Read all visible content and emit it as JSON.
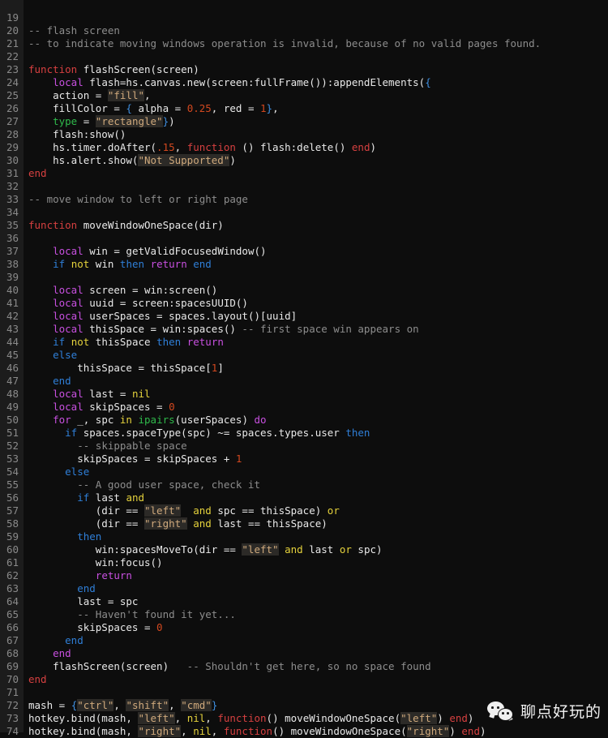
{
  "editor": {
    "language": "lua",
    "theme": "dark",
    "background_color": "#0d0d0d",
    "gutter_color": "#1c1c1c",
    "first_visible_line": 19,
    "last_visible_line": 74,
    "colors": {
      "plain": "#e9e9e9",
      "comment": "#8d8d8d",
      "keyword_red": "#d64040",
      "keyword_magenta": "#c850e0",
      "keyword_blue": "#2f7fd8",
      "keyword_yellow": "#e5d23c",
      "green": "#2fb94b",
      "number": "#d2481f",
      "brace": "#3f8fe0",
      "string_text": "#cfa97c",
      "string_background": "#2c2a27",
      "line_number": "#8a8a8a"
    }
  },
  "watermark": {
    "logo_icon": "wechat-logo-icon",
    "text": "聊点好玩的"
  },
  "lines": [
    {
      "n": 19,
      "tokens": []
    },
    {
      "n": 20,
      "tokens": [
        {
          "t": "-- flash screen",
          "c": "comment"
        }
      ]
    },
    {
      "n": 21,
      "tokens": [
        {
          "t": "-- to indicate moving windows operation is invalid, because of no valid pages found.",
          "c": "comment"
        }
      ]
    },
    {
      "n": 22,
      "tokens": []
    },
    {
      "n": 23,
      "tokens": [
        {
          "t": "function",
          "c": "kw-red"
        },
        {
          "t": " flashScreen(screen)",
          "c": "plain"
        }
      ]
    },
    {
      "n": 24,
      "tokens": [
        {
          "t": "    ",
          "c": "plain"
        },
        {
          "t": "local",
          "c": "kw-mag"
        },
        {
          "t": " flash=hs.canvas.new(screen:fullFrame()):appendElements(",
          "c": "plain"
        },
        {
          "t": "{",
          "c": "brace"
        }
      ]
    },
    {
      "n": 25,
      "tokens": [
        {
          "t": "    action = ",
          "c": "plain"
        },
        {
          "t": "\"fill\"",
          "c": "str"
        },
        {
          "t": ",",
          "c": "plain"
        }
      ]
    },
    {
      "n": 26,
      "tokens": [
        {
          "t": "    fillColor = ",
          "c": "plain"
        },
        {
          "t": "{",
          "c": "brace"
        },
        {
          "t": " alpha = ",
          "c": "plain"
        },
        {
          "t": "0.25",
          "c": "num"
        },
        {
          "t": ", red = ",
          "c": "plain"
        },
        {
          "t": "1",
          "c": "num"
        },
        {
          "t": "}",
          "c": "brace"
        },
        {
          "t": ",",
          "c": "plain"
        }
      ]
    },
    {
      "n": 27,
      "tokens": [
        {
          "t": "    ",
          "c": "plain"
        },
        {
          "t": "type",
          "c": "grn"
        },
        {
          "t": " = ",
          "c": "plain"
        },
        {
          "t": "\"rectangle\"",
          "c": "str"
        },
        {
          "t": "}",
          "c": "brace"
        },
        {
          "t": ")",
          "c": "plain"
        }
      ]
    },
    {
      "n": 28,
      "tokens": [
        {
          "t": "    flash:show()",
          "c": "plain"
        }
      ]
    },
    {
      "n": 29,
      "tokens": [
        {
          "t": "    hs.timer.doAfter(",
          "c": "plain"
        },
        {
          "t": ".15",
          "c": "num"
        },
        {
          "t": ", ",
          "c": "plain"
        },
        {
          "t": "function",
          "c": "kw-red"
        },
        {
          "t": " () flash:delete() ",
          "c": "plain"
        },
        {
          "t": "end",
          "c": "kw-red"
        },
        {
          "t": ")",
          "c": "plain"
        }
      ]
    },
    {
      "n": 30,
      "tokens": [
        {
          "t": "    hs.alert.show(",
          "c": "plain"
        },
        {
          "t": "\"Not Supported\"",
          "c": "str"
        },
        {
          "t": ")",
          "c": "plain"
        }
      ]
    },
    {
      "n": 31,
      "tokens": [
        {
          "t": "end",
          "c": "kw-red"
        }
      ]
    },
    {
      "n": 32,
      "tokens": []
    },
    {
      "n": 33,
      "tokens": [
        {
          "t": "-- move window to left or right page",
          "c": "comment"
        }
      ]
    },
    {
      "n": 34,
      "tokens": []
    },
    {
      "n": 35,
      "tokens": [
        {
          "t": "function",
          "c": "kw-red"
        },
        {
          "t": " moveWindowOneSpace(dir)",
          "c": "plain"
        }
      ]
    },
    {
      "n": 36,
      "tokens": []
    },
    {
      "n": 37,
      "tokens": [
        {
          "t": "    ",
          "c": "plain"
        },
        {
          "t": "local",
          "c": "kw-mag"
        },
        {
          "t": " win = getValidFocusedWindow()",
          "c": "plain"
        }
      ]
    },
    {
      "n": 38,
      "tokens": [
        {
          "t": "    ",
          "c": "plain"
        },
        {
          "t": "if",
          "c": "kw-blue"
        },
        {
          "t": " ",
          "c": "plain"
        },
        {
          "t": "not",
          "c": "kw-yel"
        },
        {
          "t": " win ",
          "c": "plain"
        },
        {
          "t": "then",
          "c": "kw-blue"
        },
        {
          "t": " ",
          "c": "plain"
        },
        {
          "t": "return",
          "c": "kw-mag"
        },
        {
          "t": " ",
          "c": "plain"
        },
        {
          "t": "end",
          "c": "kw-blue"
        }
      ]
    },
    {
      "n": 39,
      "tokens": []
    },
    {
      "n": 40,
      "tokens": [
        {
          "t": "    ",
          "c": "plain"
        },
        {
          "t": "local",
          "c": "kw-mag"
        },
        {
          "t": " screen = win:screen()",
          "c": "plain"
        }
      ]
    },
    {
      "n": 41,
      "tokens": [
        {
          "t": "    ",
          "c": "plain"
        },
        {
          "t": "local",
          "c": "kw-mag"
        },
        {
          "t": " uuid = screen:spacesUUID()",
          "c": "plain"
        }
      ]
    },
    {
      "n": 42,
      "tokens": [
        {
          "t": "    ",
          "c": "plain"
        },
        {
          "t": "local",
          "c": "kw-mag"
        },
        {
          "t": " userSpaces = spaces.layout()[uuid]",
          "c": "plain"
        }
      ]
    },
    {
      "n": 43,
      "tokens": [
        {
          "t": "    ",
          "c": "plain"
        },
        {
          "t": "local",
          "c": "kw-mag"
        },
        {
          "t": " thisSpace = win:spaces() ",
          "c": "plain"
        },
        {
          "t": "-- first space win appears on",
          "c": "comment"
        }
      ]
    },
    {
      "n": 44,
      "tokens": [
        {
          "t": "    ",
          "c": "plain"
        },
        {
          "t": "if",
          "c": "kw-blue"
        },
        {
          "t": " ",
          "c": "plain"
        },
        {
          "t": "not",
          "c": "kw-yel"
        },
        {
          "t": " thisSpace ",
          "c": "plain"
        },
        {
          "t": "then",
          "c": "kw-blue"
        },
        {
          "t": " ",
          "c": "plain"
        },
        {
          "t": "return",
          "c": "kw-mag"
        }
      ]
    },
    {
      "n": 45,
      "tokens": [
        {
          "t": "    ",
          "c": "plain"
        },
        {
          "t": "else",
          "c": "kw-blue"
        }
      ]
    },
    {
      "n": 46,
      "tokens": [
        {
          "t": "        thisSpace = thisSpace[",
          "c": "plain"
        },
        {
          "t": "1",
          "c": "num"
        },
        {
          "t": "]",
          "c": "plain"
        }
      ]
    },
    {
      "n": 47,
      "tokens": [
        {
          "t": "    ",
          "c": "plain"
        },
        {
          "t": "end",
          "c": "kw-blue"
        }
      ]
    },
    {
      "n": 48,
      "tokens": [
        {
          "t": "    ",
          "c": "plain"
        },
        {
          "t": "local",
          "c": "kw-mag"
        },
        {
          "t": " last = ",
          "c": "plain"
        },
        {
          "t": "nil",
          "c": "kw-yel"
        }
      ]
    },
    {
      "n": 49,
      "tokens": [
        {
          "t": "    ",
          "c": "plain"
        },
        {
          "t": "local",
          "c": "kw-mag"
        },
        {
          "t": " skipSpaces = ",
          "c": "plain"
        },
        {
          "t": "0",
          "c": "num"
        }
      ]
    },
    {
      "n": 50,
      "tokens": [
        {
          "t": "    ",
          "c": "plain"
        },
        {
          "t": "for",
          "c": "kw-mag"
        },
        {
          "t": " _, spc ",
          "c": "plain"
        },
        {
          "t": "in",
          "c": "kw-yel"
        },
        {
          "t": " ",
          "c": "plain"
        },
        {
          "t": "ipairs",
          "c": "grn"
        },
        {
          "t": "(userSpaces) ",
          "c": "plain"
        },
        {
          "t": "do",
          "c": "kw-mag"
        }
      ]
    },
    {
      "n": 51,
      "tokens": [
        {
          "t": "      ",
          "c": "plain"
        },
        {
          "t": "if",
          "c": "kw-blue"
        },
        {
          "t": " spaces.spaceType(spc) ~= spaces.types.user ",
          "c": "plain"
        },
        {
          "t": "then",
          "c": "kw-blue"
        }
      ]
    },
    {
      "n": 52,
      "tokens": [
        {
          "t": "        ",
          "c": "plain"
        },
        {
          "t": "-- skippable space",
          "c": "comment"
        }
      ]
    },
    {
      "n": 53,
      "tokens": [
        {
          "t": "        skipSpaces = skipSpaces + ",
          "c": "plain"
        },
        {
          "t": "1",
          "c": "num"
        }
      ]
    },
    {
      "n": 54,
      "tokens": [
        {
          "t": "      ",
          "c": "plain"
        },
        {
          "t": "else",
          "c": "kw-blue"
        }
      ]
    },
    {
      "n": 55,
      "tokens": [
        {
          "t": "        ",
          "c": "plain"
        },
        {
          "t": "-- A good user space, check it",
          "c": "comment"
        }
      ]
    },
    {
      "n": 56,
      "tokens": [
        {
          "t": "        ",
          "c": "plain"
        },
        {
          "t": "if",
          "c": "kw-blue"
        },
        {
          "t": " last ",
          "c": "plain"
        },
        {
          "t": "and",
          "c": "kw-yel"
        }
      ]
    },
    {
      "n": 57,
      "tokens": [
        {
          "t": "           (dir == ",
          "c": "plain"
        },
        {
          "t": "\"left\"",
          "c": "str"
        },
        {
          "t": "  ",
          "c": "plain"
        },
        {
          "t": "and",
          "c": "kw-yel"
        },
        {
          "t": " spc == thisSpace) ",
          "c": "plain"
        },
        {
          "t": "or",
          "c": "kw-yel"
        }
      ]
    },
    {
      "n": 58,
      "tokens": [
        {
          "t": "           (dir == ",
          "c": "plain"
        },
        {
          "t": "\"right\"",
          "c": "str"
        },
        {
          "t": " ",
          "c": "plain"
        },
        {
          "t": "and",
          "c": "kw-yel"
        },
        {
          "t": " last == thisSpace)",
          "c": "plain"
        }
      ]
    },
    {
      "n": 59,
      "tokens": [
        {
          "t": "        ",
          "c": "plain"
        },
        {
          "t": "then",
          "c": "kw-blue"
        }
      ]
    },
    {
      "n": 60,
      "tokens": [
        {
          "t": "           win:spacesMoveTo(dir == ",
          "c": "plain"
        },
        {
          "t": "\"left\"",
          "c": "str"
        },
        {
          "t": " ",
          "c": "plain"
        },
        {
          "t": "and",
          "c": "kw-yel"
        },
        {
          "t": " last ",
          "c": "plain"
        },
        {
          "t": "or",
          "c": "kw-yel"
        },
        {
          "t": " spc)",
          "c": "plain"
        }
      ]
    },
    {
      "n": 61,
      "tokens": [
        {
          "t": "           win:focus()",
          "c": "plain"
        }
      ]
    },
    {
      "n": 62,
      "tokens": [
        {
          "t": "           ",
          "c": "plain"
        },
        {
          "t": "return",
          "c": "kw-mag"
        }
      ]
    },
    {
      "n": 63,
      "tokens": [
        {
          "t": "        ",
          "c": "plain"
        },
        {
          "t": "end",
          "c": "kw-blue"
        }
      ]
    },
    {
      "n": 64,
      "tokens": [
        {
          "t": "        last = spc",
          "c": "plain"
        }
      ]
    },
    {
      "n": 65,
      "tokens": [
        {
          "t": "        ",
          "c": "plain"
        },
        {
          "t": "-- Haven't found it yet...",
          "c": "comment"
        }
      ]
    },
    {
      "n": 66,
      "tokens": [
        {
          "t": "        skipSpaces = ",
          "c": "plain"
        },
        {
          "t": "0",
          "c": "num"
        }
      ]
    },
    {
      "n": 67,
      "tokens": [
        {
          "t": "      ",
          "c": "plain"
        },
        {
          "t": "end",
          "c": "kw-blue"
        }
      ]
    },
    {
      "n": 68,
      "tokens": [
        {
          "t": "    ",
          "c": "plain"
        },
        {
          "t": "end",
          "c": "kw-mag"
        }
      ]
    },
    {
      "n": 69,
      "tokens": [
        {
          "t": "    flashScreen(screen)   ",
          "c": "plain"
        },
        {
          "t": "-- Shouldn't get here, so no space found",
          "c": "comment"
        }
      ]
    },
    {
      "n": 70,
      "tokens": [
        {
          "t": "end",
          "c": "kw-red"
        }
      ]
    },
    {
      "n": 71,
      "tokens": []
    },
    {
      "n": 72,
      "tokens": [
        {
          "t": "mash = ",
          "c": "plain"
        },
        {
          "t": "{",
          "c": "brace"
        },
        {
          "t": "\"ctrl\"",
          "c": "str"
        },
        {
          "t": ", ",
          "c": "plain"
        },
        {
          "t": "\"shift\"",
          "c": "str"
        },
        {
          "t": ", ",
          "c": "plain"
        },
        {
          "t": "\"cmd\"",
          "c": "str"
        },
        {
          "t": "}",
          "c": "brace"
        }
      ]
    },
    {
      "n": 73,
      "tokens": [
        {
          "t": "hotkey.bind(mash, ",
          "c": "plain"
        },
        {
          "t": "\"left\"",
          "c": "str"
        },
        {
          "t": ", ",
          "c": "plain"
        },
        {
          "t": "nil",
          "c": "kw-yel"
        },
        {
          "t": ", ",
          "c": "plain"
        },
        {
          "t": "function",
          "c": "kw-red"
        },
        {
          "t": "() moveWindowOneSpace(",
          "c": "plain"
        },
        {
          "t": "\"left\"",
          "c": "str"
        },
        {
          "t": ") ",
          "c": "plain"
        },
        {
          "t": "end",
          "c": "kw-red"
        },
        {
          "t": ")",
          "c": "plain"
        }
      ]
    },
    {
      "n": 74,
      "tokens": [
        {
          "t": "hotkey.bind(mash, ",
          "c": "plain"
        },
        {
          "t": "\"right\"",
          "c": "str"
        },
        {
          "t": ", ",
          "c": "plain"
        },
        {
          "t": "nil",
          "c": "kw-yel"
        },
        {
          "t": ", ",
          "c": "plain"
        },
        {
          "t": "function",
          "c": "kw-red"
        },
        {
          "t": "() moveWindowOneSpace(",
          "c": "plain"
        },
        {
          "t": "\"right\"",
          "c": "str"
        },
        {
          "t": ") ",
          "c": "plain"
        },
        {
          "t": "end",
          "c": "kw-red"
        },
        {
          "t": ")",
          "c": "plain"
        }
      ]
    }
  ]
}
